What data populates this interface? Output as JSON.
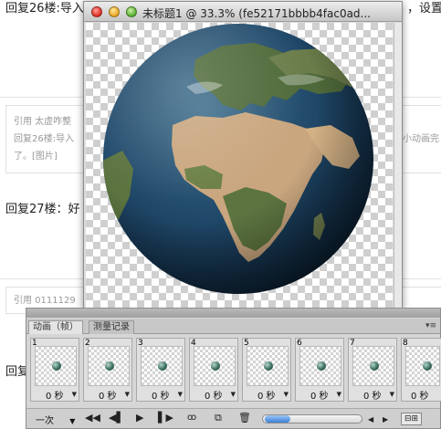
{
  "forum": {
    "reply26_full": "回复26楼:导入",
    "reply26_tail": "，设置",
    "quote1_head": "引用 太虚咋整",
    "quote1_line2": "回复26楼:导入",
    "quote1_right": "小动画完",
    "quote1_line3": "了。[图片]",
    "reply27": "回复27楼：好",
    "quote2_head": "引用 0111129",
    "reply_bottom": "回复"
  },
  "image_window": {
    "title": "未标题1 @ 33.3% (fe52171bbbb4fac0ad..."
  },
  "animation_panel": {
    "tabs": [
      "动画（帧）",
      "测量记录"
    ],
    "frames": [
      {
        "number": "1",
        "delay": "0 秒"
      },
      {
        "number": "2",
        "delay": "0 秒"
      },
      {
        "number": "3",
        "delay": "0 秒"
      },
      {
        "number": "4",
        "delay": "0 秒"
      },
      {
        "number": "5",
        "delay": "0 秒"
      },
      {
        "number": "6",
        "delay": "0 秒"
      },
      {
        "number": "7",
        "delay": "0 秒"
      },
      {
        "number": "8",
        "delay": "0 秒"
      }
    ],
    "loop": "一次",
    "icons": [
      "first-frame-icon",
      "prev-frame-icon",
      "play-icon",
      "next-frame-icon",
      "tween-icon",
      "duplicate-frame-icon",
      "delete-frame-icon",
      "convert-timeline-icon"
    ]
  },
  "colors": {
    "ocean": "#1f4768",
    "land_desert": "#c9a67e",
    "land_green": "#4f6a3a",
    "panel_bg": "#d6d6d6"
  }
}
